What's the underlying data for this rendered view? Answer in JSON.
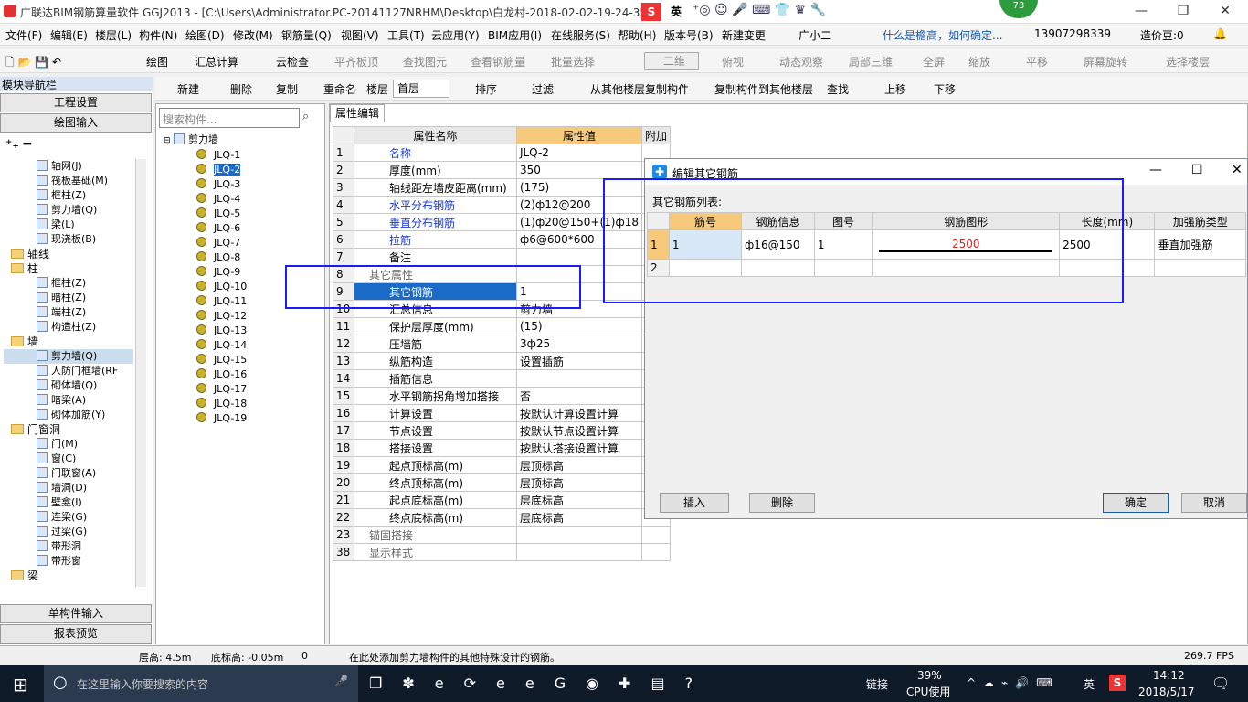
{
  "window": {
    "title": "广联达BIM钢筋算量软件 GGJ2013 - [C:\\Users\\Administrator.PC-20141127NRHM\\Desktop\\白龙村-2018-02-02-19-24-35",
    "badge": "73",
    "ime": "英"
  },
  "menu": [
    "文件(F)",
    "编辑(E)",
    "楼层(L)",
    "构件(N)",
    "绘图(D)",
    "修改(M)",
    "钢筋量(Q)",
    "视图(V)",
    "工具(T)",
    "云应用(Y)",
    "BIM应用(I)",
    "在线服务(S)",
    "帮助(H)",
    "版本号(B)",
    "新建变更",
    "广小二",
    "什么是檐高，如何确定...",
    "13907298339",
    "造价豆:0"
  ],
  "toolbar1": [
    "绘图",
    "汇总计算",
    "云检查",
    "平齐板顶",
    "查找图元",
    "查看钢筋量",
    "批量选择",
    "二维",
    "俯视",
    "动态观察",
    "局部三维",
    "全屏",
    "缩放",
    "平移",
    "屏幕旋转",
    "选择楼层"
  ],
  "toolbar2": [
    "新建",
    "删除",
    "复制",
    "重命名",
    "楼层",
    "首层",
    "排序",
    "过滤",
    "从其他楼层复制构件",
    "复制构件到其他楼层",
    "查找",
    "上移",
    "下移"
  ],
  "nav": {
    "header": "模块导航栏",
    "top_buttons": [
      "工程设置",
      "绘图输入"
    ],
    "bottom_buttons": [
      "单构件输入",
      "报表预览"
    ],
    "tree": [
      {
        "label": "轴网(J)",
        "level": 2
      },
      {
        "label": "筏板基础(M)",
        "level": 2
      },
      {
        "label": "框柱(Z)",
        "level": 2
      },
      {
        "label": "剪力墙(Q)",
        "level": 2
      },
      {
        "label": "梁(L)",
        "level": 2
      },
      {
        "label": "现浇板(B)",
        "level": 2
      },
      {
        "label": "轴线",
        "level": 1
      },
      {
        "label": "柱",
        "level": 1
      },
      {
        "label": "框柱(Z)",
        "level": 2
      },
      {
        "label": "暗柱(Z)",
        "level": 2
      },
      {
        "label": "端柱(Z)",
        "level": 2
      },
      {
        "label": "构造柱(Z)",
        "level": 2
      },
      {
        "label": "墙",
        "level": 1
      },
      {
        "label": "剪力墙(Q)",
        "level": 2
      },
      {
        "label": "人防门框墙(RF",
        "level": 2
      },
      {
        "label": "砌体墙(Q)",
        "level": 2
      },
      {
        "label": "暗梁(A)",
        "level": 2
      },
      {
        "label": "砌体加筋(Y)",
        "level": 2
      },
      {
        "label": "门窗洞",
        "level": 1
      },
      {
        "label": "门(M)",
        "level": 2
      },
      {
        "label": "窗(C)",
        "level": 2
      },
      {
        "label": "门联窗(A)",
        "level": 2
      },
      {
        "label": "墙洞(D)",
        "level": 2
      },
      {
        "label": "壁龛(I)",
        "level": 2
      },
      {
        "label": "连梁(G)",
        "level": 2
      },
      {
        "label": "过梁(G)",
        "level": 2
      },
      {
        "label": "带形洞",
        "level": 2
      },
      {
        "label": "带形窗",
        "level": 2
      },
      {
        "label": "梁",
        "level": 1
      }
    ]
  },
  "components": {
    "search_placeholder": "搜索构件...",
    "root": "剪力墙",
    "items": [
      "JLQ-1",
      "JLQ-2",
      "JLQ-3",
      "JLQ-4",
      "JLQ-5",
      "JLQ-6",
      "JLQ-7",
      "JLQ-8",
      "JLQ-9",
      "JLQ-10",
      "JLQ-11",
      "JLQ-12",
      "JLQ-13",
      "JLQ-14",
      "JLQ-15",
      "JLQ-16",
      "JLQ-17",
      "JLQ-18",
      "JLQ-19"
    ],
    "selected": "JLQ-2"
  },
  "props": {
    "tab": "属性编辑",
    "col_name": "属性名称",
    "col_value": "属性值",
    "col_extra": "附加",
    "rows": [
      {
        "n": "1",
        "name": "名称",
        "value": "JLQ-2",
        "blue": true
      },
      {
        "n": "2",
        "name": "厚度(mm)",
        "value": "350"
      },
      {
        "n": "3",
        "name": "轴线距左墙皮距离(mm)",
        "value": "(175)"
      },
      {
        "n": "4",
        "name": "水平分布钢筋",
        "value": "(2)ф12@200",
        "blue": true
      },
      {
        "n": "5",
        "name": "垂直分布钢筋",
        "value": "(1)ф20@150+(1)ф18",
        "blue": true
      },
      {
        "n": "6",
        "name": "拉筋",
        "value": "ф6@600*600",
        "blue": true
      },
      {
        "n": "7",
        "name": "备注",
        "value": ""
      },
      {
        "n": "8",
        "name": "其它属性",
        "value": "",
        "group": true
      },
      {
        "n": "9",
        "name": "其它钢筋",
        "value": "1",
        "sel": true
      },
      {
        "n": "10",
        "name": "汇总信息",
        "value": "剪力墙"
      },
      {
        "n": "11",
        "name": "保护层厚度(mm)",
        "value": "(15)"
      },
      {
        "n": "12",
        "name": "压墙筋",
        "value": "3ф25"
      },
      {
        "n": "13",
        "name": "纵筋构造",
        "value": "设置插筋"
      },
      {
        "n": "14",
        "name": "插筋信息",
        "value": ""
      },
      {
        "n": "15",
        "name": "水平钢筋拐角增加搭接",
        "value": "否"
      },
      {
        "n": "16",
        "name": "计算设置",
        "value": "按默认计算设置计算"
      },
      {
        "n": "17",
        "name": "节点设置",
        "value": "按默认节点设置计算"
      },
      {
        "n": "18",
        "name": "搭接设置",
        "value": "按默认搭接设置计算"
      },
      {
        "n": "19",
        "name": "起点顶标高(m)",
        "value": "层顶标高"
      },
      {
        "n": "20",
        "name": "终点顶标高(m)",
        "value": "层顶标高"
      },
      {
        "n": "21",
        "name": "起点底标高(m)",
        "value": "层底标高"
      },
      {
        "n": "22",
        "name": "终点底标高(m)",
        "value": "层底标高"
      },
      {
        "n": "23",
        "name": "锚固搭接",
        "value": "",
        "group": true
      },
      {
        "n": "38",
        "name": "显示样式",
        "value": "",
        "group": true
      }
    ]
  },
  "dialog": {
    "title": "编辑其它钢筋",
    "list_label": "其它钢筋列表:",
    "headers": [
      "筋号",
      "钢筋信息",
      "图号",
      "钢筋图形",
      "长度(mm)",
      "加强筋类型"
    ],
    "rows": [
      {
        "n": "1",
        "c": [
          "1",
          "ф16@150",
          "1",
          "2500",
          "2500",
          "垂直加强筋"
        ]
      },
      {
        "n": "2",
        "c": [
          "",
          "",
          "",
          "",
          "",
          ""
        ]
      }
    ],
    "insert": "插入",
    "delete": "删除",
    "ok": "确定",
    "cancel": "取消"
  },
  "status": {
    "floor_height": "层高: 4.5m",
    "base_elev": "底标高: -0.05m",
    "zero": "0",
    "hint": "在此处添加剪力墙构件的其他特殊设计的钢筋。",
    "fps": "269.7 FPS"
  },
  "taskbar": {
    "search": "在这里输入你要搜索的内容",
    "link": "链接",
    "cpu": "39%",
    "cpu_label": "CPU使用",
    "ime": "英",
    "time": "14:12",
    "date": "2018/5/17"
  }
}
